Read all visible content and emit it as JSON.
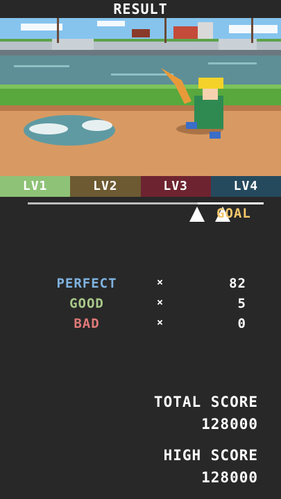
{
  "header": {
    "title": "RESULT"
  },
  "levels": [
    {
      "label": "LV1",
      "color": "#8ec276"
    },
    {
      "label": "LV2",
      "color": "#6d5a32"
    },
    {
      "label": "LV3",
      "color": "#6e2430"
    },
    {
      "label": "LV4",
      "color": "#254a5e"
    }
  ],
  "progress": {
    "goal_label": "GOAL"
  },
  "judgements": [
    {
      "label": "PERFECT",
      "times": "×",
      "count": "82",
      "color": "#7fb3e0"
    },
    {
      "label": "GOOD",
      "times": "×",
      "count": "5",
      "color": "#a8c98a"
    },
    {
      "label": "BAD",
      "times": "×",
      "count": "0",
      "color": "#e07a78"
    }
  ],
  "scores": {
    "total_label": "TOTAL SCORE",
    "total_value": "128000",
    "high_label": "HIGH SCORE",
    "high_value": "128000"
  }
}
